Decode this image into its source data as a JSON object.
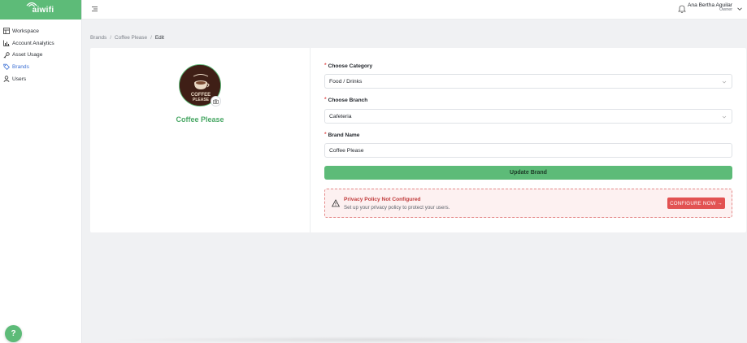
{
  "app": {
    "logo_text": "aiwifi",
    "brand_color": "#5dbb78"
  },
  "sidebar": {
    "items": [
      {
        "label": "Workspace",
        "icon": "grid-icon",
        "active": false
      },
      {
        "label": "Account Analytics",
        "icon": "chart-icon",
        "active": false
      },
      {
        "label": "Asset Usage",
        "icon": "key-icon",
        "active": false
      },
      {
        "label": "Brands",
        "icon": "tag-icon",
        "active": true
      },
      {
        "label": "Users",
        "icon": "user-icon",
        "active": false
      }
    ],
    "help_label": "?"
  },
  "header": {
    "user_name": "Ana Bertha Aguilar",
    "user_role": "Owner"
  },
  "breadcrumb": {
    "items": [
      "Brands",
      "Coffee Please",
      "Edit"
    ],
    "separator": "/"
  },
  "brand": {
    "display_name": "Coffee Please",
    "logo_text_line1": "COFFEE",
    "logo_text_line2": "PLEASE"
  },
  "form": {
    "category_label": "Choose Category",
    "category_value": "Food / Drinks",
    "branch_label": "Choose Branch",
    "branch_value": "Cafeteria",
    "name_label": "Brand Name",
    "name_value": "Coffee Please",
    "required_mark": "*",
    "update_label": "Update Brand"
  },
  "alert": {
    "title": "Privacy Policy Not Configured",
    "text": "Set up your privacy policy to protect your users.",
    "button_label": "CONFIGURE NOW →"
  }
}
